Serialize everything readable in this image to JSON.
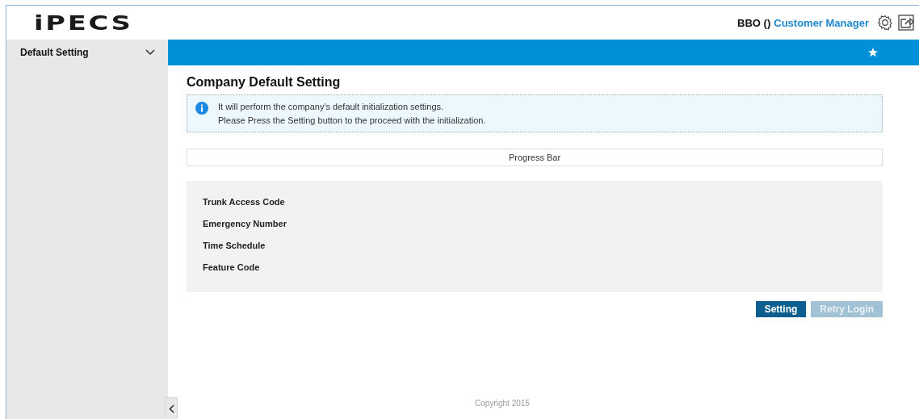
{
  "header": {
    "logo": "iPECS",
    "user_code": "BBO ()",
    "user_role": "Customer Manager"
  },
  "sidebar": {
    "items": [
      {
        "label": "Default Setting",
        "expanded": true
      }
    ]
  },
  "page": {
    "title": "Company Default Setting",
    "info": [
      "It will perform the company's default initialization settings.",
      "Please Press the Setting button to the proceed with the initialization."
    ],
    "progress": {
      "label": "Progress Bar"
    },
    "steps": [
      "Trunk Access Code",
      "Emergency Number",
      "Time Schedule",
      "Feature Code"
    ],
    "buttons": [
      {
        "label": "Setting",
        "disabled": false
      },
      {
        "label": "Retry Login",
        "disabled": true
      }
    ]
  },
  "footer": {
    "copyright": "Copyright 2015"
  }
}
